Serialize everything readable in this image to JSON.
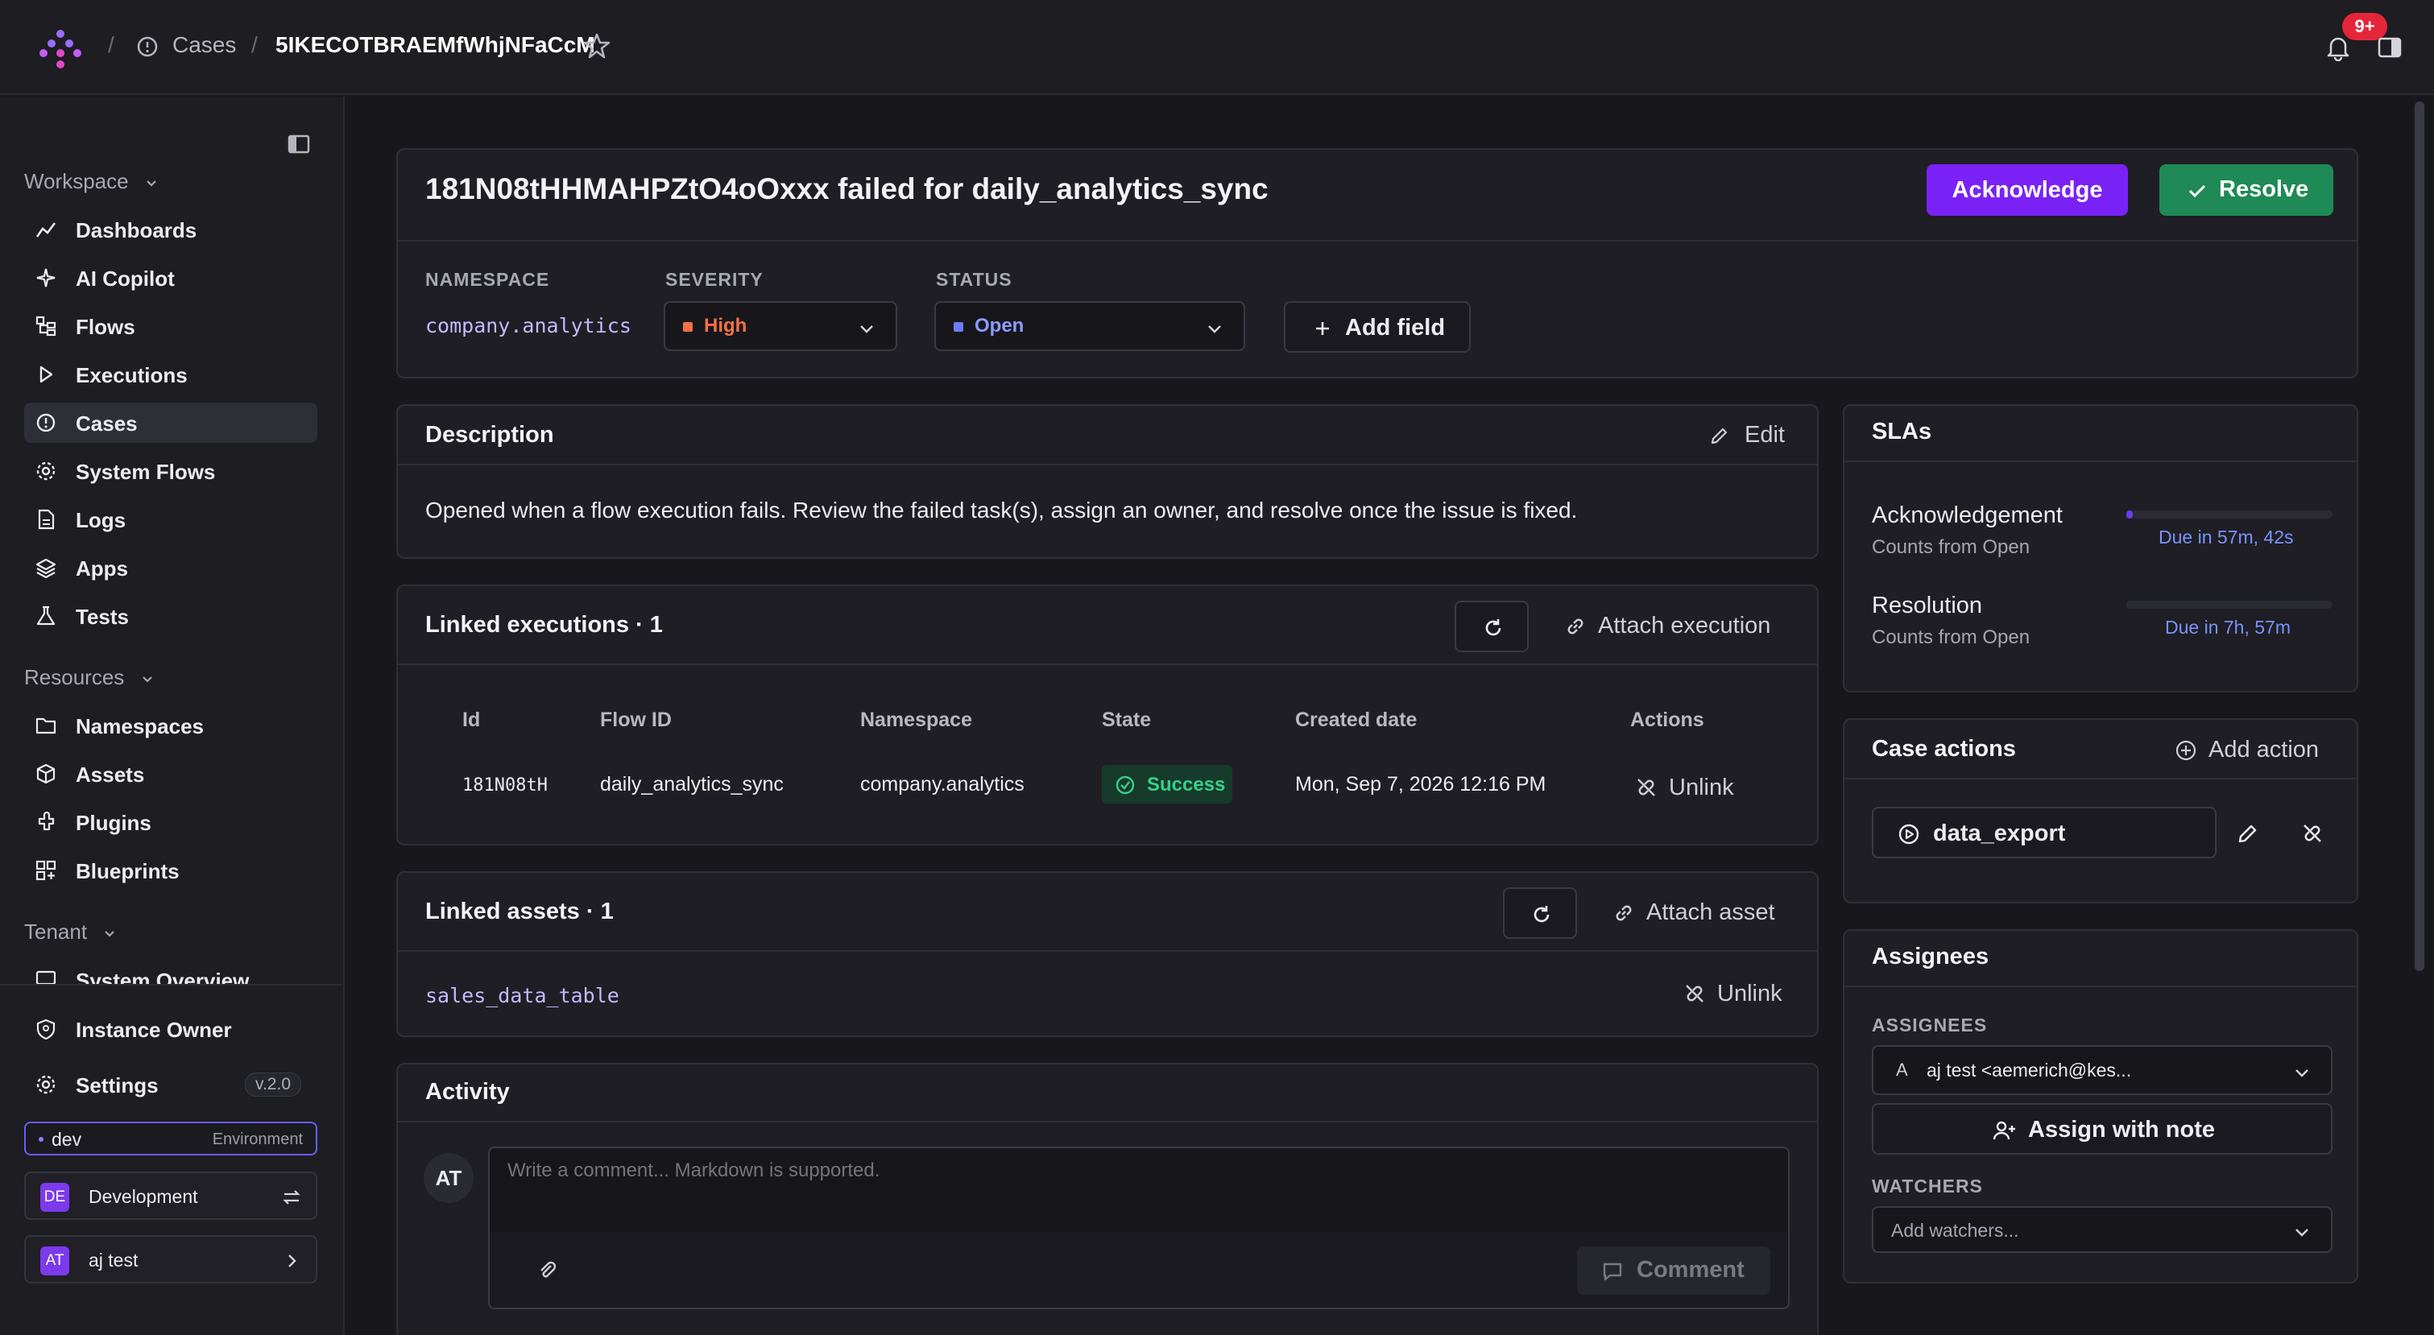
{
  "breadcrumb": {
    "section": "Cases",
    "id": "5IKECOTBRAEMfWhjNFaCcM"
  },
  "header": {
    "notifications_badge": "9+"
  },
  "sidebar": {
    "workspace_label": "Workspace",
    "workspace_items": [
      {
        "label": "Dashboards",
        "icon": "chart-line-icon"
      },
      {
        "label": "AI Copilot",
        "icon": "sparkle-icon"
      },
      {
        "label": "Flows",
        "icon": "flow-tree-icon"
      },
      {
        "label": "Executions",
        "icon": "play-icon"
      },
      {
        "label": "Cases",
        "icon": "alert-circle-icon",
        "active": true
      },
      {
        "label": "System Flows",
        "icon": "gear-icon"
      },
      {
        "label": "Logs",
        "icon": "file-text-icon"
      },
      {
        "label": "Apps",
        "icon": "layers-icon"
      },
      {
        "label": "Tests",
        "icon": "flask-icon"
      }
    ],
    "resources_label": "Resources",
    "resources_items": [
      {
        "label": "Namespaces",
        "icon": "folder-icon"
      },
      {
        "label": "Assets",
        "icon": "cube-icon"
      },
      {
        "label": "Plugins",
        "icon": "plug-icon"
      },
      {
        "label": "Blueprints",
        "icon": "grid-plus-icon"
      }
    ],
    "tenant_label": "Tenant",
    "tenant_items": [
      {
        "label": "System Overview",
        "icon": "monitor-icon"
      }
    ],
    "instance_owner": "Instance Owner",
    "settings": "Settings",
    "version": "v.2.0",
    "environment": {
      "name": "dev",
      "label": "Environment"
    },
    "tenant_switch": {
      "initials": "DE",
      "label": "Development"
    },
    "user": {
      "initials": "AT",
      "label": "aj test"
    }
  },
  "case": {
    "title": "181N08tHHMAHPZtO4oOxxx failed for daily_analytics_sync",
    "acknowledge_label": "Acknowledge",
    "resolve_label": "Resolve",
    "namespace_label": "NAMESPACE",
    "namespace_value": "company.analytics",
    "severity_label": "SEVERITY",
    "severity_value": "High",
    "status_label": "STATUS",
    "status_value": "Open",
    "add_field_label": "Add field"
  },
  "description": {
    "title": "Description",
    "edit_label": "Edit",
    "text": "Opened when a flow execution fails. Review the failed task(s), assign an owner, and resolve once the issue is fixed."
  },
  "linked_executions": {
    "title": "Linked executions · 1",
    "attach_label": "Attach execution",
    "columns": [
      "Id",
      "Flow ID",
      "Namespace",
      "State",
      "Created date",
      "Actions"
    ],
    "rows": [
      {
        "id": "181N08tH",
        "flow_id": "daily_analytics_sync",
        "namespace": "company.analytics",
        "state": "Success",
        "created": "Mon, Sep 7, 2026 12:16 PM",
        "action": "Unlink"
      }
    ]
  },
  "linked_assets": {
    "title": "Linked assets · 1",
    "attach_label": "Attach asset",
    "asset": "sales_data_table",
    "unlink_label": "Unlink"
  },
  "activity": {
    "title": "Activity",
    "avatar": "AT",
    "placeholder": "Write a comment... Markdown is supported.",
    "comment_label": "Comment"
  },
  "slas": {
    "title": "SLAs",
    "items": [
      {
        "name": "Acknowledgement",
        "sub": "Counts from Open",
        "due": "Due in 57m, 42s",
        "progress": 0.03
      },
      {
        "name": "Resolution",
        "sub": "Counts from Open",
        "due": "Due in 7h, 57m",
        "progress": 0.0
      }
    ]
  },
  "case_actions": {
    "title": "Case actions",
    "add_label": "Add action",
    "action_name": "data_export"
  },
  "assignees": {
    "title": "Assignees",
    "assignees_label": "ASSIGNEES",
    "assignee_initial": "A",
    "assignee_value": "aj test <aemerich@kes...",
    "assign_note_label": "Assign with note",
    "watchers_label": "WATCHERS",
    "watchers_placeholder": "Add watchers..."
  },
  "colors": {
    "accent": "#7a22f6",
    "resolve": "#1f8a55",
    "severity_high": "#f97045",
    "status_open": "#6b7cff",
    "success": "#35d08a",
    "link_blue": "#7a93ff"
  }
}
